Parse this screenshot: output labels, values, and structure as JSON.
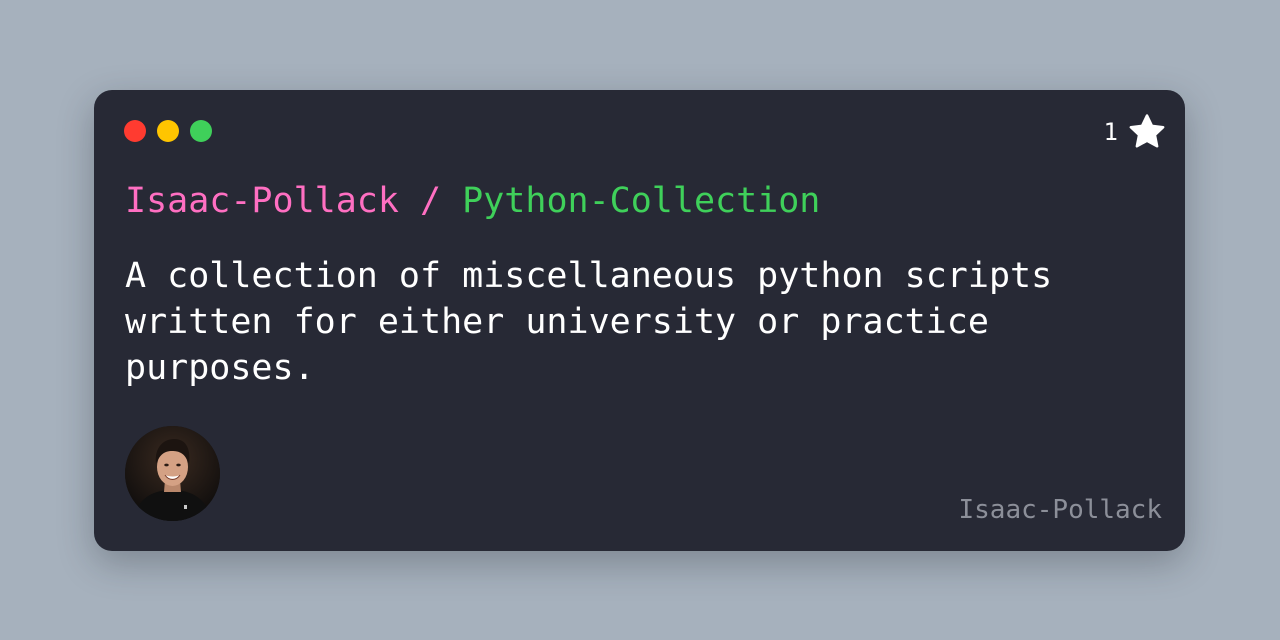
{
  "card": {
    "owner": "Isaac-Pollack",
    "separator": " / ",
    "repo": "Python-Collection",
    "description": "A collection of miscellaneous python scripts written for either university or practice purposes.",
    "star_count": "1",
    "author": "Isaac-Pollack",
    "window_dots": [
      {
        "name": "close-dot",
        "color": "#ff3b30"
      },
      {
        "name": "minimize-dot",
        "color": "#ffc500"
      },
      {
        "name": "maximize-dot",
        "color": "#3fd05a"
      }
    ],
    "icons": {
      "star": "star-icon",
      "avatar": "avatar"
    }
  },
  "colors": {
    "background": "#a6b1bd",
    "card": "#272935",
    "owner": "#ff6fc2",
    "repo": "#3fd05a",
    "text": "#ffffff",
    "author": "#8c8f99"
  }
}
